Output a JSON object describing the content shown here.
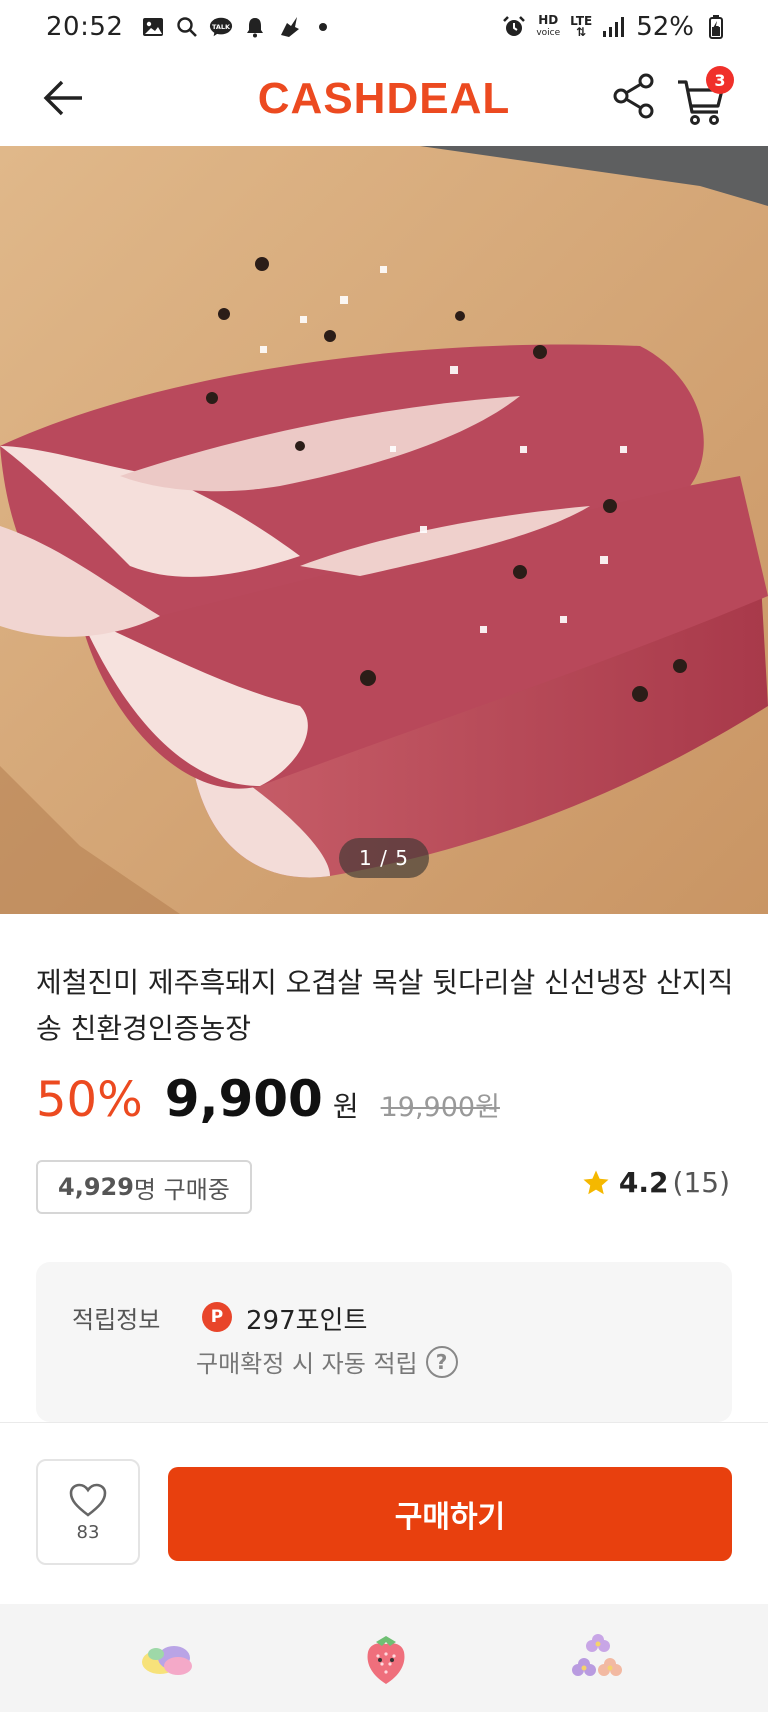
{
  "status_bar": {
    "time": "20:52",
    "hd_label": "HD",
    "voice_label": "voice",
    "lte_label": "LTE",
    "battery": "52%",
    "icons": [
      "gallery-icon",
      "search-icon",
      "talk-icon",
      "bell-icon",
      "vpn-icon",
      "dot-icon",
      "alarm-icon",
      "signal-icon",
      "battery-icon"
    ]
  },
  "header": {
    "logo": "CASHDEAL",
    "cart_count": "3",
    "icons": [
      "back-arrow-icon",
      "share-icon",
      "cart-icon"
    ]
  },
  "gallery": {
    "pager": "1 / 5"
  },
  "product": {
    "title": "제철진미 제주흑돼지 오겹살 목살 뒷다리살 신선냉장 산지직송 친환경인증농장",
    "discount": "50%",
    "price": "9,900",
    "currency": "원",
    "original_price": "19,900원",
    "buyers_count": "4,929",
    "buyers_suffix": "명 구매중",
    "rating": "4.2",
    "review_count": "(15)"
  },
  "points": {
    "label": "적립정보",
    "icon_letter": "P",
    "value": "297포인트",
    "note": "구매확정 시 자동 적립",
    "help": "?"
  },
  "actions": {
    "like_count": "83",
    "buy_label": "구매하기"
  },
  "colors": {
    "brand": "#ec4a20",
    "buy_button": "#e8400e",
    "badge": "#f0302a"
  }
}
